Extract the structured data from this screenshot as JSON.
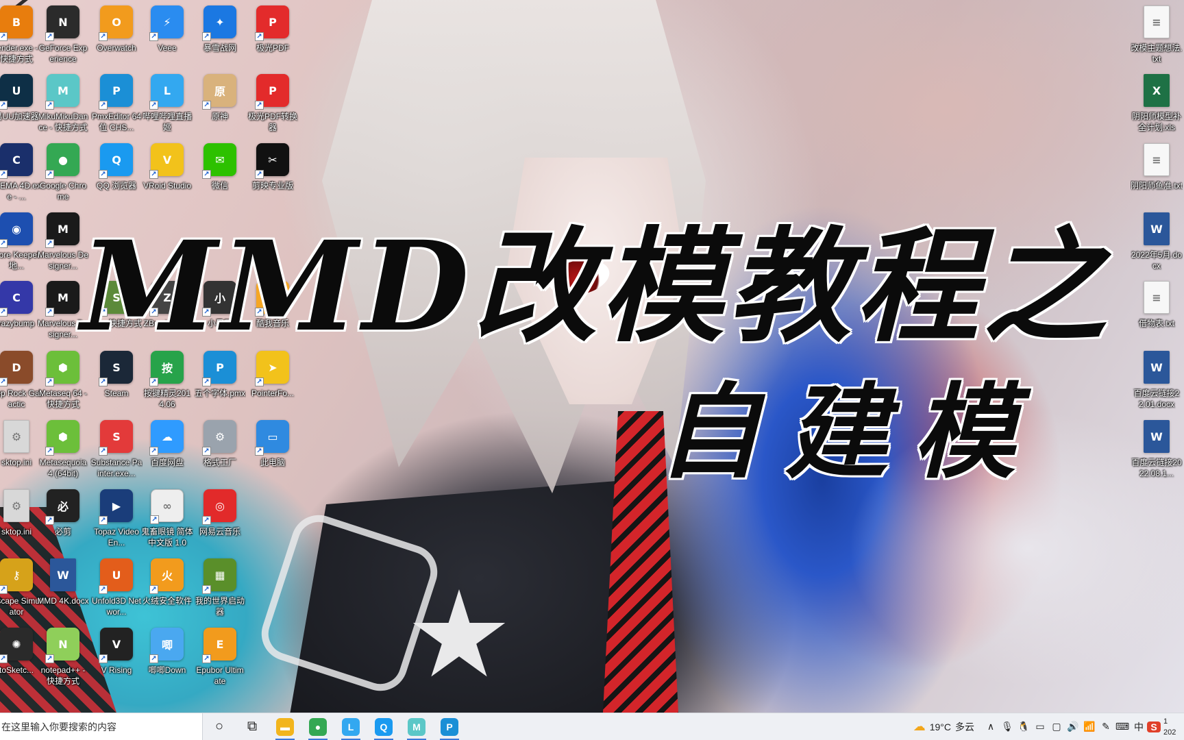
{
  "overlay": {
    "title_line1": "MMD改模教程之",
    "title_line2": "自建模"
  },
  "desktop_icons_left": [
    {
      "label": "lender.exe - 快捷方式",
      "icon": "blender-icon",
      "color": "#e87d0d",
      "glyph": "B"
    },
    {
      "label": "GeForce Experience",
      "icon": "nvidia-icon",
      "color": "#2b2b2b",
      "glyph": "N"
    },
    {
      "label": "Overwatch",
      "icon": "overwatch-icon",
      "color": "#f29b1d",
      "glyph": "O"
    },
    {
      "label": "Veee",
      "icon": "veee-icon",
      "color": "#2a8cf0",
      "glyph": "⚡"
    },
    {
      "label": "暴雪战网",
      "icon": "battlenet-icon",
      "color": "#1b78e2",
      "glyph": "✦"
    },
    {
      "label": "极光PDF",
      "icon": "pdf-icon",
      "color": "#e32b2b",
      "glyph": "P"
    },
    {
      "label": "易UU加速器",
      "icon": "uu-accelerator-icon",
      "color": "#0e2f46",
      "glyph": "U"
    },
    {
      "label": "MikuMikuDance - 快捷方式",
      "icon": "miku-icon",
      "color": "#5bc7c7",
      "glyph": "M"
    },
    {
      "label": "PmxEditor 64位 CHS...",
      "icon": "pmx-editor-icon",
      "color": "#1b8fd6",
      "glyph": "P"
    },
    {
      "label": "哔哩哔哩直播姬",
      "icon": "bilibili-live-icon",
      "color": "#33a8f0",
      "glyph": "L"
    },
    {
      "label": "原神",
      "icon": "genshin-icon",
      "color": "#d9b27c",
      "glyph": "原"
    },
    {
      "label": "极光PDF转换器",
      "icon": "pdf-converter-icon",
      "color": "#e32b2b",
      "glyph": "P"
    },
    {
      "label": "INEMA 4D.exe - ...",
      "icon": "cinema4d-icon",
      "color": "#1a2f6b",
      "glyph": "C"
    },
    {
      "label": "Google Chrome",
      "icon": "chrome-icon",
      "color": "#34a853",
      "glyph": "●"
    },
    {
      "label": "QQ 浏览器",
      "icon": "qq-browser-icon",
      "color": "#1a9af0",
      "glyph": "Q"
    },
    {
      "label": "VRoid Studio",
      "icon": "vroid-icon",
      "color": "#f2c21b",
      "glyph": "V"
    },
    {
      "label": "微信",
      "icon": "wechat-icon",
      "color": "#2dc100",
      "glyph": "✉"
    },
    {
      "label": "剪映专业版",
      "icon": "capcut-icon",
      "color": "#111111",
      "glyph": "✂"
    },
    {
      "label": "Core Keeper 地...",
      "icon": "core-keeper-icon",
      "color": "#1d4fb0",
      "glyph": "◉"
    },
    {
      "label": "Marvelous Designer...",
      "icon": "marvelous-icon",
      "color": "#1a1a1a",
      "glyph": "M"
    },
    {
      "label": "razybump",
      "icon": "crazybump-icon",
      "color": "#3438a8",
      "glyph": "C"
    },
    {
      "label": "Marvelous Designer...",
      "icon": "marvelous-icon-2",
      "color": "#1a1a1a",
      "glyph": "M"
    },
    {
      "label": "sai - 快捷方式",
      "icon": "sai-icon",
      "color": "#5c8a3a",
      "glyph": "S"
    },
    {
      "label": "ZBrush 2020",
      "icon": "zbrush-icon",
      "color": "#444444",
      "glyph": "Z"
    },
    {
      "label": "小黑屋",
      "icon": "xiaoheiwu-icon",
      "color": "#333333",
      "glyph": "小"
    },
    {
      "label": "酷我音乐",
      "icon": "kuwo-icon",
      "color": "#f5a623",
      "glyph": "K"
    },
    {
      "label": "eep Rock Galactic",
      "icon": "deep-rock-icon",
      "color": "#8a4b2a",
      "glyph": "D"
    },
    {
      "label": "Metaseq 64 - 快捷方式",
      "icon": "metaseq-icon",
      "color": "#6cbf3a",
      "glyph": "⬢"
    },
    {
      "label": "Steam",
      "icon": "steam-icon",
      "color": "#1b2838",
      "glyph": "S"
    },
    {
      "label": "按键精灵2014.06",
      "icon": "anjian-icon",
      "color": "#27a34a",
      "glyph": "按"
    },
    {
      "label": "五个字体.pmx",
      "icon": "pmx-file-icon",
      "color": "#1b8fd6",
      "glyph": "P"
    },
    {
      "label": "PointerFo...",
      "icon": "pointerfocus-icon",
      "color": "#f2c21b",
      "glyph": "➤"
    },
    {
      "label": "sktop.ini",
      "icon": "ini-file-icon",
      "color": "#d8d8d8",
      "glyph": "⚙"
    },
    {
      "label": "Metasequoia 4 (64bit)",
      "icon": "metasequoia-icon",
      "color": "#6cbf3a",
      "glyph": "⬢"
    },
    {
      "label": "Substance Painter.exe...",
      "icon": "substance-icon",
      "color": "#e33a3a",
      "glyph": "S"
    },
    {
      "label": "百度网盘",
      "icon": "baidu-netdisk-icon",
      "color": "#2f9bff",
      "glyph": "☁"
    },
    {
      "label": "格式工厂",
      "icon": "format-factory-icon",
      "color": "#9aa3ad",
      "glyph": "⚙"
    },
    {
      "label": "此电脑",
      "icon": "this-pc-icon",
      "color": "#2f8ae0",
      "glyph": "▭"
    },
    {
      "label": "sktop.ini",
      "icon": "ini-file-icon-2",
      "color": "#d8d8d8",
      "glyph": "⚙"
    },
    {
      "label": "必剪",
      "icon": "bijian-icon",
      "color": "#222222",
      "glyph": "必"
    },
    {
      "label": "Topaz Video En...",
      "icon": "topaz-icon",
      "color": "#1a3d7a",
      "glyph": "▶"
    },
    {
      "label": "鬼畜眼镜 简体中文版 1.0",
      "icon": "glasses-icon",
      "color": "#eeeeee",
      "glyph": "∞"
    },
    {
      "label": "网易云音乐",
      "icon": "netease-music-icon",
      "color": "#e22a2a",
      "glyph": "◎"
    },
    {
      "label": "Escape Simulator",
      "icon": "escape-sim-icon",
      "color": "#d6a21a",
      "glyph": "⚷"
    },
    {
      "label": "MMD 4K.docx",
      "icon": "word-doc-icon",
      "color": "#2b579a",
      "glyph": "W"
    },
    {
      "label": "Unfold3D Networ...",
      "icon": "unfold3d-icon",
      "color": "#e35d1b",
      "glyph": "U"
    },
    {
      "label": "火绒安全软件",
      "icon": "huorong-icon",
      "color": "#f29b1d",
      "glyph": "火"
    },
    {
      "label": "我的世界启动器",
      "icon": "minecraft-icon",
      "color": "#5a8f2a",
      "glyph": "▦"
    },
    {
      "label": "toSketc...",
      "icon": "autosketch-icon",
      "color": "#2a2a2a",
      "glyph": "✺"
    },
    {
      "label": "notepad++ - 快捷方式",
      "icon": "notepadpp-icon",
      "color": "#8fcf5a",
      "glyph": "N"
    },
    {
      "label": "V Rising",
      "icon": "vrising-icon",
      "color": "#222222",
      "glyph": "V"
    },
    {
      "label": "唧唧Down",
      "icon": "jijidown-icon",
      "color": "#4aa8f0",
      "glyph": "唧"
    },
    {
      "label": "Epubor Ultimate",
      "icon": "epubor-icon",
      "color": "#f29b1d",
      "glyph": "E"
    }
  ],
  "desktop_icons_right": [
    {
      "label": "改模主题想法.txt",
      "icon": "txt-file-icon",
      "color": "#f7f7f7",
      "glyph": "≡"
    },
    {
      "label": "阴阳师模型补全计划.xls",
      "icon": "excel-file-icon",
      "color": "#1e7145",
      "glyph": "X"
    },
    {
      "label": "阴阳师鱼准.txt",
      "icon": "txt-file-icon-2",
      "color": "#f7f7f7",
      "glyph": "≡"
    },
    {
      "label": "2022年5月.docx",
      "icon": "word-file-icon",
      "color": "#2b579a",
      "glyph": "W"
    },
    {
      "label": "借物表.txt",
      "icon": "txt-file-icon-3",
      "color": "#f7f7f7",
      "glyph": "≡"
    },
    {
      "label": "百度云链接22.01.docx",
      "icon": "word-file-icon-2",
      "color": "#2b579a",
      "glyph": "W"
    },
    {
      "label": "百度云链接2022.08.1...",
      "icon": "word-file-icon-3",
      "color": "#2b579a",
      "glyph": "W"
    }
  ],
  "taskbar": {
    "search_placeholder": "在这里输入你要搜索的内容",
    "pinned": [
      {
        "name": "cortana-icon",
        "glyph": "○",
        "color": ""
      },
      {
        "name": "task-view-icon",
        "glyph": "⧉",
        "color": ""
      },
      {
        "name": "file-explorer-icon",
        "glyph": "▬",
        "color": "#f2b51d"
      },
      {
        "name": "chrome-taskbar-icon",
        "glyph": "●",
        "color": "#34a853"
      },
      {
        "name": "bilibili-live-taskbar-icon",
        "glyph": "L",
        "color": "#33a8f0"
      },
      {
        "name": "qq-browser-taskbar-icon",
        "glyph": "Q",
        "color": "#1a9af0"
      },
      {
        "name": "miku-taskbar-icon",
        "glyph": "M",
        "color": "#5bc7c7"
      },
      {
        "name": "pmx-editor-taskbar-icon",
        "glyph": "P",
        "color": "#1b8fd6"
      }
    ],
    "weather_temp": "19°C",
    "weather_desc": "多云",
    "tray_icons": [
      {
        "name": "show-hidden-icons-icon",
        "glyph": "∧"
      },
      {
        "name": "microphone-icon",
        "glyph": "🎙"
      },
      {
        "name": "qq-tray-icon",
        "glyph": "🐧"
      },
      {
        "name": "battery-icon",
        "glyph": "▭"
      },
      {
        "name": "display-icon",
        "glyph": "▢"
      },
      {
        "name": "volume-icon",
        "glyph": "🔊"
      },
      {
        "name": "network-icon",
        "glyph": "📶"
      },
      {
        "name": "pen-icon",
        "glyph": "✎"
      },
      {
        "name": "keyboard-icon",
        "glyph": "⌨"
      },
      {
        "name": "input-method-icon",
        "glyph": "中"
      },
      {
        "name": "wps-tray-icon",
        "glyph": "S"
      }
    ],
    "clock_time": "1",
    "clock_date": "202"
  }
}
